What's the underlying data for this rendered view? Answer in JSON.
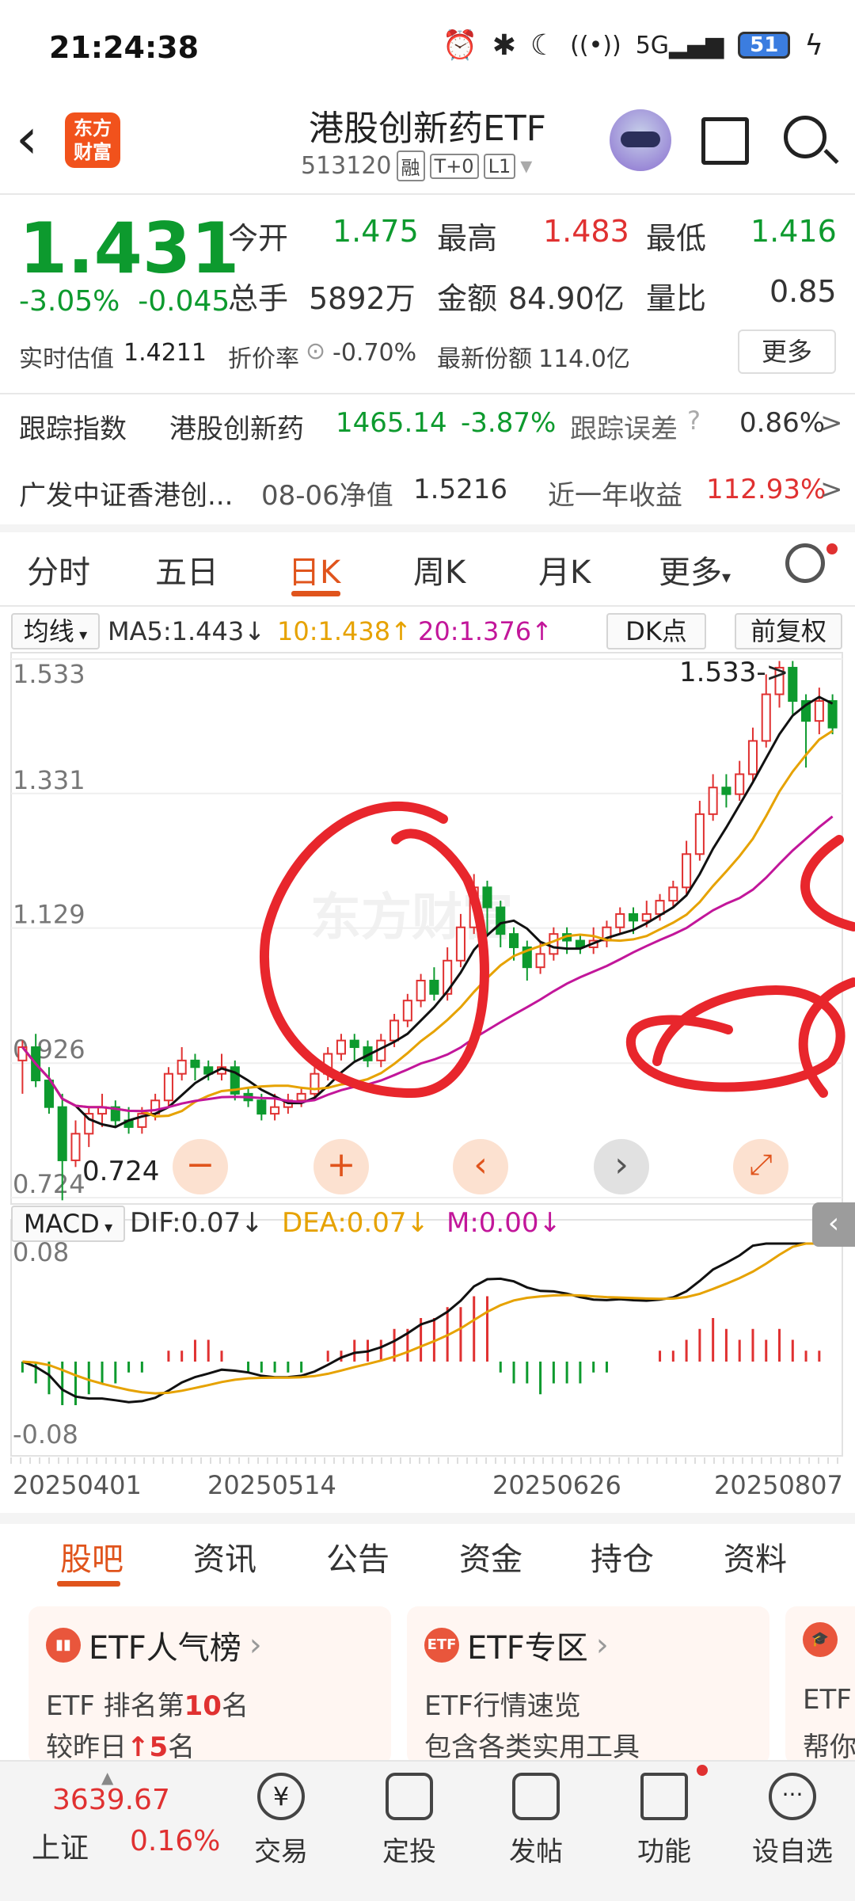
{
  "status": {
    "time": "21:24:38",
    "battery": "51"
  },
  "header": {
    "title": "港股创新药ETF",
    "code": "513120",
    "tags": [
      "融",
      "T+0",
      "L1"
    ],
    "logo_line1": "东方",
    "logo_line2": "财富"
  },
  "quote": {
    "price": "1.431",
    "change_pct": "-3.05%",
    "change": "-0.045",
    "open_label": "今开",
    "open": "1.475",
    "high_label": "最高",
    "high": "1.483",
    "low_label": "最低",
    "low": "1.416",
    "volume_label": "总手",
    "volume": "5892万",
    "amount_label": "金额",
    "amount": "84.90亿",
    "ratio_label": "量比",
    "ratio": "0.85",
    "est_label": "实时估值",
    "est": "1.4211",
    "discount_label": "折价率",
    "discount": "-0.70%",
    "shares_label": "最新份额",
    "shares": "114.0亿",
    "more": "更多"
  },
  "tracking": {
    "label": "跟踪指数",
    "index_name": "港股创新药",
    "index_value": "1465.14",
    "index_chg": "-3.87%",
    "error_label": "跟踪误差",
    "error": "0.86%",
    "arrow": ">"
  },
  "fund": {
    "name": "广发中证香港创...",
    "nav_label": "08-06净值",
    "nav": "1.5216",
    "year_label": "近一年收益",
    "year_ret": "112.93%",
    "arrow": ">"
  },
  "period_tabs": [
    "分时",
    "五日",
    "日K",
    "周K",
    "月K",
    "更多"
  ],
  "ma_row": {
    "selector": "均线",
    "ma5": "MA5:1.443↓",
    "ma10": "10:1.438↑",
    "ma20": "20:1.376↑",
    "dk": "DK点",
    "adjust": "前复权"
  },
  "macd_row": {
    "selector": "MACD",
    "dif": "DIF:0.07↓",
    "dea": "DEA:0.07↓",
    "m": "M:0.00↓"
  },
  "chart_data": {
    "type": "candlestick",
    "y_ticks": [
      "1.533",
      "1.331",
      "1.129",
      "0.926",
      "0.724"
    ],
    "ylim": [
      0.724,
      1.533
    ],
    "max_label": "1.533->",
    "min_label": "0.724",
    "macd_ticks": [
      "0.08",
      "-0.08"
    ],
    "x_labels": [
      "20250401",
      "20250514",
      "20250626",
      "20250807"
    ],
    "watermark": "东方财富",
    "colors": {
      "up": "#e03131",
      "down": "#0d9a2e",
      "ma5": "#111111",
      "ma10": "#e6a200",
      "ma20": "#c2169a"
    },
    "candles": [
      [
        0.93,
        0.95,
        0.88,
        0.96
      ],
      [
        0.95,
        0.9,
        0.89,
        0.97
      ],
      [
        0.9,
        0.86,
        0.85,
        0.92
      ],
      [
        0.86,
        0.78,
        0.72,
        0.88
      ],
      [
        0.78,
        0.82,
        0.77,
        0.84
      ],
      [
        0.82,
        0.85,
        0.8,
        0.86
      ],
      [
        0.85,
        0.86,
        0.83,
        0.88
      ],
      [
        0.86,
        0.84,
        0.83,
        0.87
      ],
      [
        0.84,
        0.83,
        0.82,
        0.86
      ],
      [
        0.83,
        0.85,
        0.82,
        0.86
      ],
      [
        0.85,
        0.87,
        0.84,
        0.88
      ],
      [
        0.87,
        0.91,
        0.86,
        0.92
      ],
      [
        0.91,
        0.93,
        0.9,
        0.95
      ],
      [
        0.93,
        0.92,
        0.9,
        0.94
      ],
      [
        0.92,
        0.91,
        0.9,
        0.93
      ],
      [
        0.91,
        0.92,
        0.9,
        0.94
      ],
      [
        0.92,
        0.88,
        0.87,
        0.93
      ],
      [
        0.88,
        0.87,
        0.86,
        0.89
      ],
      [
        0.87,
        0.85,
        0.84,
        0.88
      ],
      [
        0.85,
        0.86,
        0.84,
        0.88
      ],
      [
        0.86,
        0.87,
        0.85,
        0.88
      ],
      [
        0.87,
        0.88,
        0.86,
        0.89
      ],
      [
        0.88,
        0.91,
        0.87,
        0.92
      ],
      [
        0.91,
        0.94,
        0.9,
        0.95
      ],
      [
        0.94,
        0.96,
        0.93,
        0.97
      ],
      [
        0.96,
        0.95,
        0.93,
        0.97
      ],
      [
        0.95,
        0.93,
        0.92,
        0.96
      ],
      [
        0.93,
        0.96,
        0.92,
        0.97
      ],
      [
        0.96,
        0.99,
        0.95,
        1.0
      ],
      [
        0.99,
        1.02,
        0.98,
        1.03
      ],
      [
        1.02,
        1.05,
        1.01,
        1.06
      ],
      [
        1.05,
        1.03,
        1.02,
        1.07
      ],
      [
        1.03,
        1.08,
        1.02,
        1.1
      ],
      [
        1.08,
        1.13,
        1.07,
        1.15
      ],
      [
        1.13,
        1.19,
        1.12,
        1.21
      ],
      [
        1.19,
        1.16,
        1.12,
        1.2
      ],
      [
        1.16,
        1.12,
        1.1,
        1.17
      ],
      [
        1.12,
        1.1,
        1.08,
        1.13
      ],
      [
        1.1,
        1.07,
        1.05,
        1.11
      ],
      [
        1.07,
        1.09,
        1.06,
        1.11
      ],
      [
        1.09,
        1.12,
        1.08,
        1.13
      ],
      [
        1.12,
        1.11,
        1.09,
        1.13
      ],
      [
        1.11,
        1.1,
        1.09,
        1.12
      ],
      [
        1.1,
        1.11,
        1.09,
        1.13
      ],
      [
        1.11,
        1.13,
        1.1,
        1.14
      ],
      [
        1.13,
        1.15,
        1.12,
        1.16
      ],
      [
        1.15,
        1.14,
        1.12,
        1.16
      ],
      [
        1.14,
        1.15,
        1.13,
        1.17
      ],
      [
        1.15,
        1.17,
        1.14,
        1.18
      ],
      [
        1.17,
        1.19,
        1.16,
        1.2
      ],
      [
        1.19,
        1.24,
        1.18,
        1.26
      ],
      [
        1.24,
        1.3,
        1.23,
        1.32
      ],
      [
        1.3,
        1.34,
        1.29,
        1.36
      ],
      [
        1.34,
        1.33,
        1.31,
        1.36
      ],
      [
        1.33,
        1.36,
        1.32,
        1.38
      ],
      [
        1.36,
        1.41,
        1.35,
        1.43
      ],
      [
        1.41,
        1.48,
        1.4,
        1.51
      ],
      [
        1.48,
        1.52,
        1.46,
        1.53
      ],
      [
        1.52,
        1.47,
        1.45,
        1.53
      ],
      [
        1.47,
        1.44,
        1.37,
        1.48
      ],
      [
        1.44,
        1.47,
        1.42,
        1.49
      ],
      [
        1.47,
        1.43,
        1.42,
        1.48
      ]
    ],
    "macd": [
      -0.01,
      -0.02,
      -0.03,
      -0.04,
      -0.04,
      -0.03,
      -0.02,
      -0.02,
      -0.01,
      -0.01,
      0.0,
      0.01,
      0.01,
      0.02,
      0.02,
      0.01,
      0.0,
      -0.01,
      -0.01,
      -0.01,
      -0.01,
      -0.01,
      0.0,
      0.01,
      0.01,
      0.02,
      0.02,
      0.02,
      0.03,
      0.03,
      0.04,
      0.04,
      0.05,
      0.05,
      0.06,
      0.06,
      -0.01,
      -0.02,
      -0.02,
      -0.03,
      -0.02,
      -0.02,
      -0.02,
      -0.01,
      -0.01,
      0.0,
      0.0,
      0.0,
      0.01,
      0.01,
      0.02,
      0.03,
      0.04,
      0.03,
      0.02,
      0.03,
      0.02,
      0.03,
      0.02,
      0.01,
      0.01,
      0.0
    ]
  },
  "info_tabs": [
    "股吧",
    "资讯",
    "公告",
    "资金",
    "持仓",
    "资料"
  ],
  "cards": [
    {
      "icon": "chart-icon",
      "title": "ETF人气榜",
      "line1a": "ETF 排名第",
      "line1b": "10",
      "line1c": "名",
      "line2a": "较昨日",
      "line2b": "↑5",
      "line2c": "名"
    },
    {
      "icon": "etf-icon",
      "title": "ETF专区",
      "line1": "ETF行情速览",
      "line2": "包含各类实用工具"
    },
    {
      "icon": "grad-cap-icon",
      "title": "",
      "line1": "ETF",
      "line2": "帮你"
    }
  ],
  "bottom_nav": {
    "index_value": "3639.67",
    "index_name": "上证",
    "index_chg": "0.16%",
    "items": [
      "交易",
      "定投",
      "发帖",
      "功能",
      "设自选"
    ]
  }
}
